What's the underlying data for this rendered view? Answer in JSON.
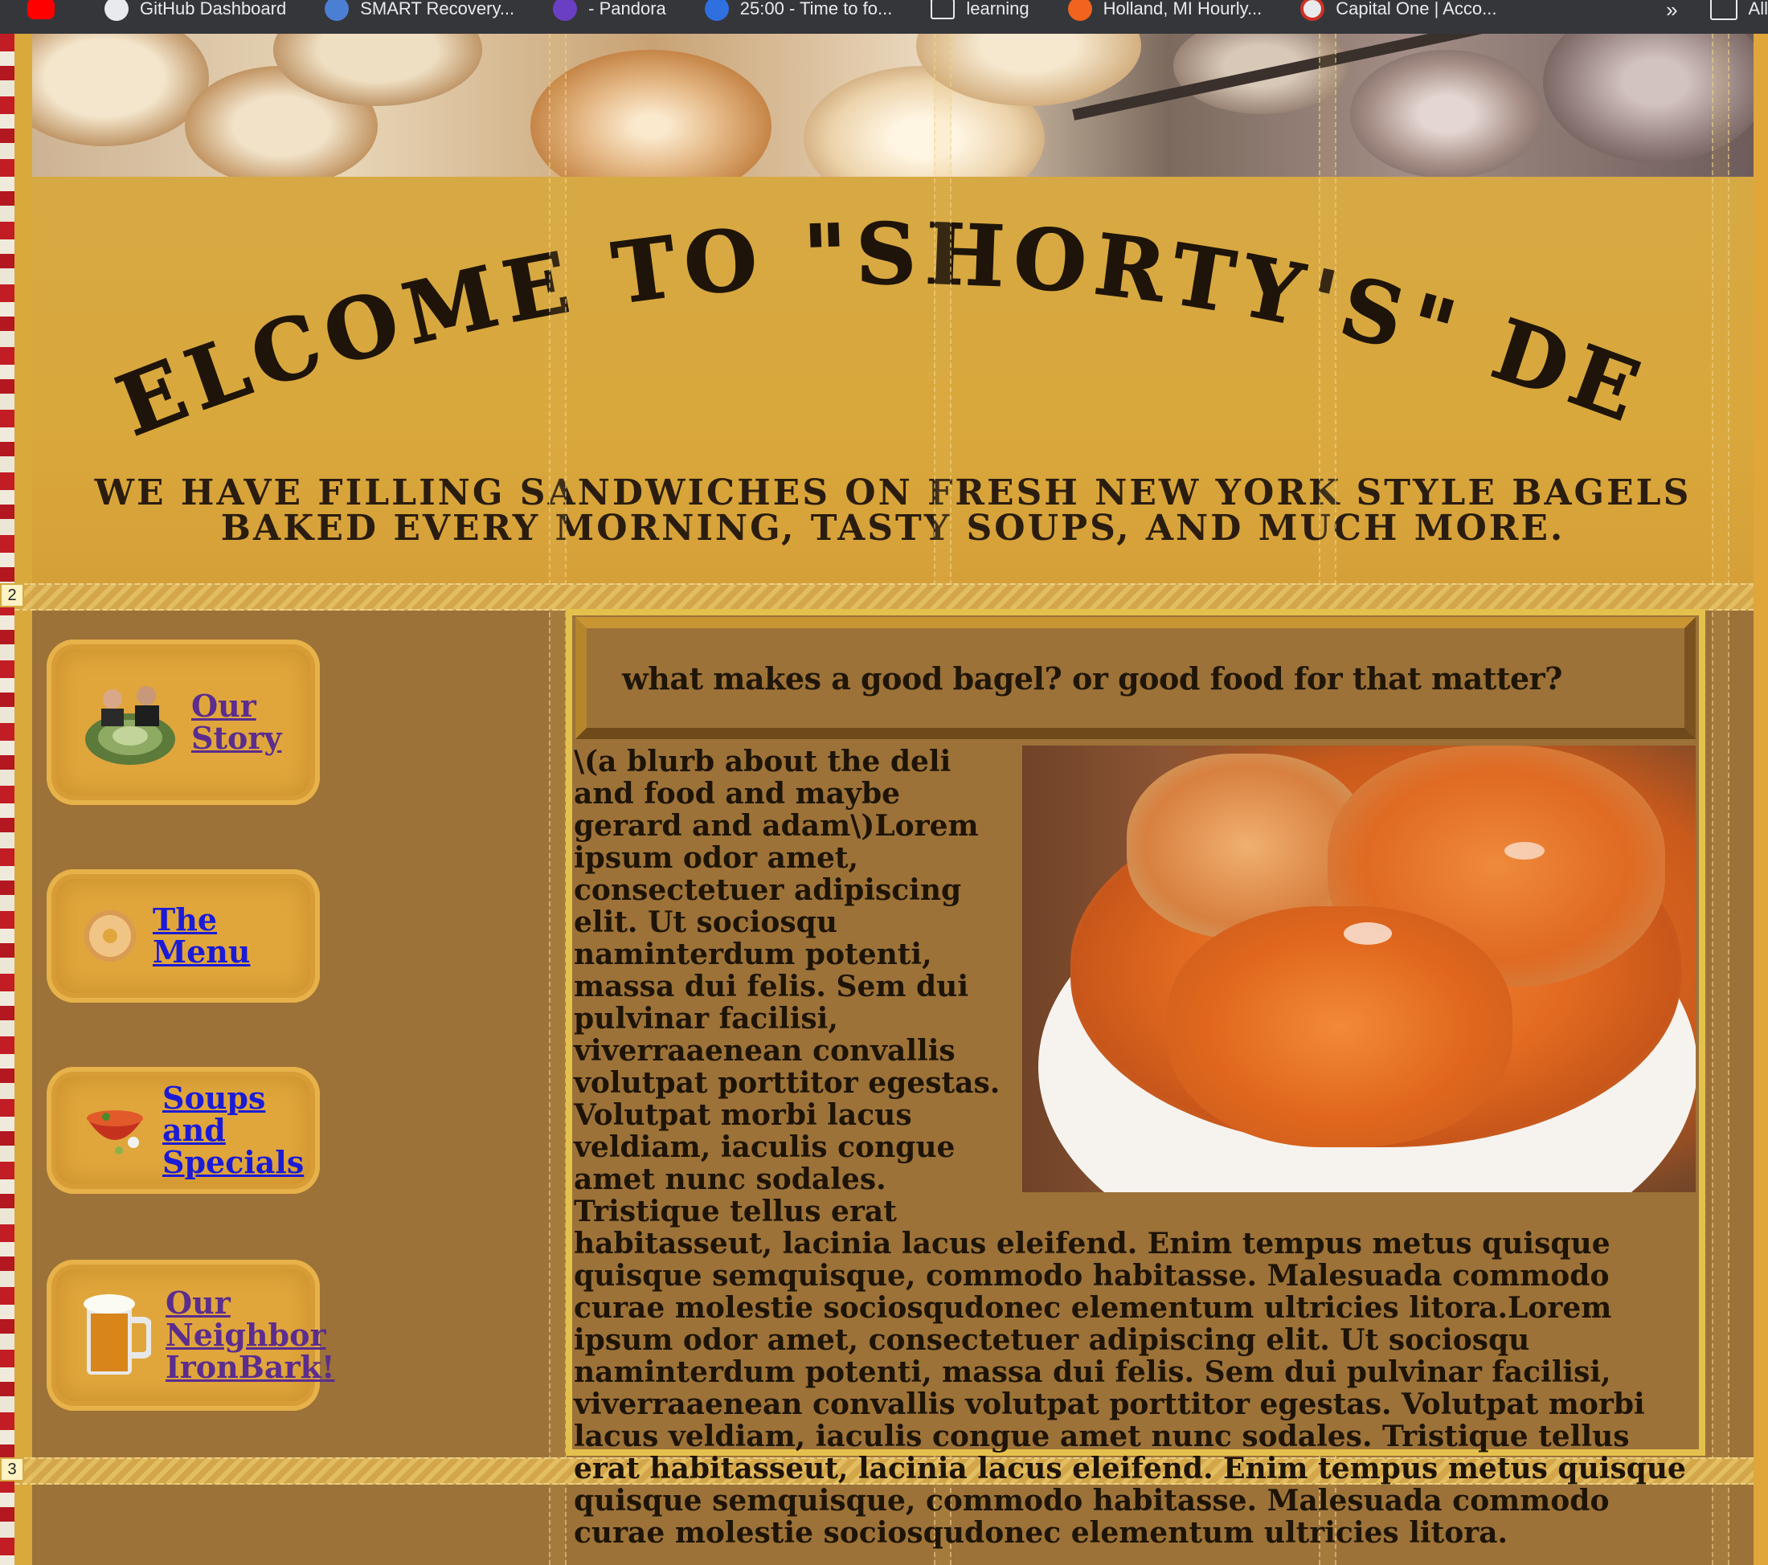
{
  "bookmarks": {
    "items": [
      {
        "label": "GitHub Dashboard",
        "icon": "github-icon"
      },
      {
        "label": "SMART Recovery...",
        "icon": "smart-recovery-icon"
      },
      {
        "label": "- Pandora",
        "icon": "pandora-icon"
      },
      {
        "label": "25:00 - Time to fo...",
        "icon": "checkmark-icon"
      },
      {
        "label": "learning",
        "icon": "folder-icon"
      },
      {
        "label": "Holland, MI Hourly...",
        "icon": "weather-icon"
      },
      {
        "label": "Capital One | Acco...",
        "icon": "capital-one-icon"
      }
    ],
    "more": "»",
    "all_label": "All"
  },
  "header": {
    "title": "WELCOME TO \"SHORTY'S\" DELI",
    "subtitle": "We have filling sandwiches on fresh New York style bagels baked every morning, tasty soups, and much more."
  },
  "grid_labels": {
    "row2": "2",
    "row3": "3"
  },
  "nav": [
    {
      "label": "Our Story",
      "icon": "owners-cabbage-icon",
      "visited": true
    },
    {
      "label": "The Menu",
      "icon": "bagel-icon",
      "visited": false
    },
    {
      "label": "Soups and Specials",
      "icon": "soup-bowl-icon",
      "visited": false
    },
    {
      "label": "Our Neighbor IronBark!",
      "icon": "beer-mug-icon",
      "visited": true
    }
  ],
  "main": {
    "question": "what makes a good bagel? or good food for that matter?",
    "image_alt": "cabbage-rolls-image",
    "body": "\\(a blurb about the deli and food and maybe gerard and adam\\)Lorem ipsum odor amet, consectetuer adipiscing elit. Ut sociosqu naminterdum potenti, massa dui felis. Sem dui pulvinar facilisi, viverraaenean convallis volutpat porttitor egestas. Volutpat morbi lacus veldiam, iaculis congue amet nunc sodales. Tristique tellus erat habitasseut, lacinia lacus eleifend. Enim tempus metus quisque quisque semquisque, commodo habitasse. Malesuada commodo curae molestie sociosqudonec elementum ultricies litora.Lorem ipsum odor amet, consectetuer adipiscing elit. Ut sociosqu naminterdum potenti, massa dui felis. Sem dui pulvinar facilisi, viverraaenean convallis volutpat porttitor egestas. Volutpat morbi lacus veldiam, iaculis congue amet nunc sodales. Tristique tellus erat habitasseut, lacinia lacus eleifend. Enim tempus metus quisque quisque semquisque, commodo habitasse. Malesuada commodo curae molestie sociosqudonec elementum ultricies litora."
  },
  "colors": {
    "page_background": "#9c7238",
    "header_gold": "#d7a944",
    "link_visited": "#5b2d8e",
    "link_unvisited": "#1b1bd6",
    "content_border": "#e4c14c"
  }
}
